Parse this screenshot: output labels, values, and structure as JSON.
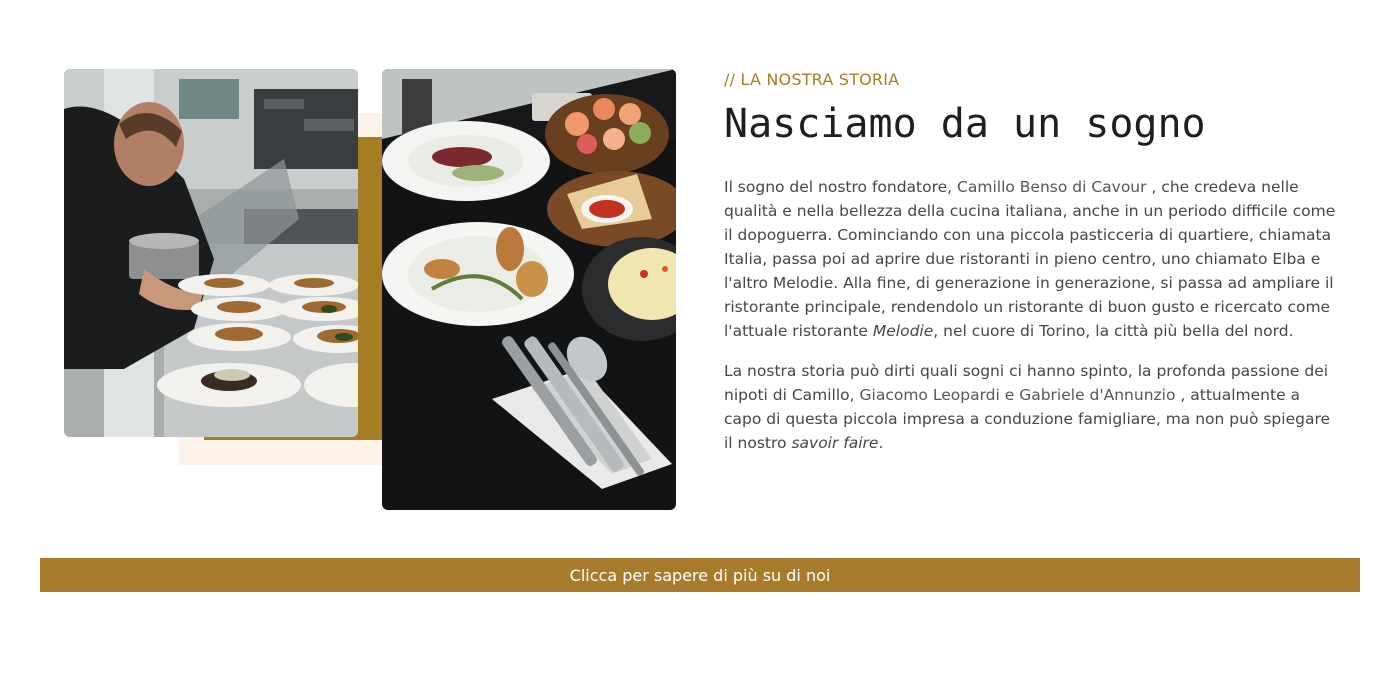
{
  "story": {
    "eyebrow": "// LA NOSTRA STORIA",
    "title": "Nasciamo da un sogno",
    "paragraph1": {
      "t1": "Il sogno del nostro fondatore, ",
      "founder": "Camillo Benso di Cavour",
      "t2": " , che credeva nelle qualità e nella bellezza della cucina italiana, anche in un periodo difficile come il dopoguerra. Cominciando con una piccola pasticceria di quartiere, chiamata Italia, passa poi ad aprire due ristoranti in pieno centro, uno chiamato Elba e l'altro Melodie. Alla fine, di generazione in generazione, si passa ad ampliare il ristorante principale, rendendolo un ristorante di buon gusto e ricercato come l'attuale ristorante ",
      "restaurant": "Melodie",
      "t3": ", nel cuore di Torino, la città più bella del nord."
    },
    "paragraph2": {
      "t1": "La nostra storia può dirti quali sogni ci hanno spinto, la profonda passione dei nipoti di Camillo, ",
      "nephews": "Giacomo Leopardi e Gabriele d'Annunzio",
      "t2": " , attualmente a capo di questa piccola impresa a conduzione famigliare, ma non può spiegare il nostro ",
      "phrase": "savoir faire",
      "t3": "."
    }
  },
  "cta": {
    "label": "Clicca per sapere di più su di noi"
  },
  "images": {
    "left": "chef-plating-photo",
    "right": "restaurant-table-photo"
  },
  "colors": {
    "accent": "#a67c25",
    "cream": "#fdf2e8",
    "text": "#454545",
    "heading": "#1e1e1e"
  }
}
